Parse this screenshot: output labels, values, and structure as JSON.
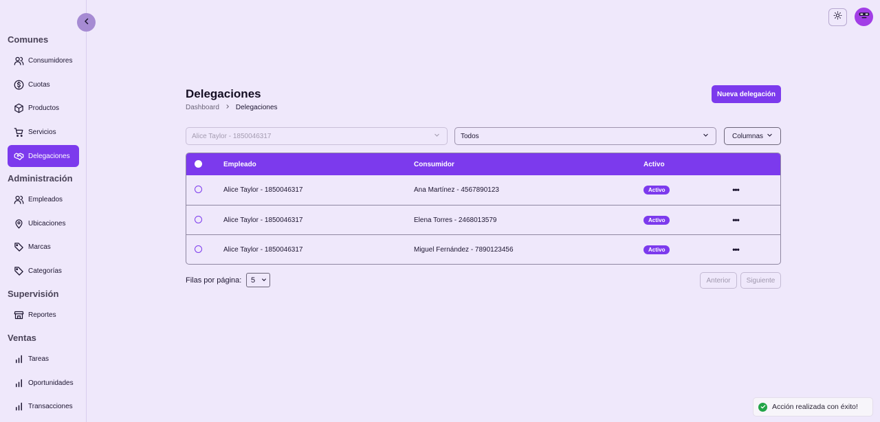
{
  "sidebar": {
    "sections": [
      {
        "title": "Comunes"
      },
      {
        "title": "Administración"
      },
      {
        "title": "Supervisión"
      },
      {
        "title": "Ventas"
      }
    ],
    "items": [
      {
        "label": "Consumidores",
        "icon": "users-icon"
      },
      {
        "label": "Cuotas",
        "icon": "dollar-circle-icon"
      },
      {
        "label": "Productos",
        "icon": "package-icon"
      },
      {
        "label": "Servicios",
        "icon": "cart-icon"
      },
      {
        "label": "Delegaciones",
        "icon": "handshake-icon",
        "active": true
      },
      {
        "label": "Empleados",
        "icon": "users-icon"
      },
      {
        "label": "Ubicaciones",
        "icon": "map-pin-icon"
      },
      {
        "label": "Marcas",
        "icon": "tag-icon"
      },
      {
        "label": "Categorías",
        "icon": "tag-icon"
      },
      {
        "label": "Reportes",
        "icon": "store-icon"
      },
      {
        "label": "Tareas",
        "icon": "bar-chart-icon"
      },
      {
        "label": "Oportunidades",
        "icon": "bar-chart-icon"
      },
      {
        "label": "Transacciones",
        "icon": "bar-chart-icon"
      }
    ]
  },
  "header": {
    "title": "Delegaciones",
    "breadcrumb": [
      "Dashboard",
      "Delegaciones"
    ],
    "new_button": "Nueva delegación"
  },
  "filters": {
    "employee_select": "Alice Taylor - 1850046317",
    "status_select": "Todos",
    "columns_button": "Columnas"
  },
  "table": {
    "columns": [
      "Empleado",
      "Consumidor",
      "Activo"
    ],
    "rows": [
      {
        "employee": "Alice Taylor - 1850046317",
        "consumer": "Ana Martínez - 4567890123",
        "status": "Activo"
      },
      {
        "employee": "Alice Taylor - 1850046317",
        "consumer": "Elena Torres - 2468013579",
        "status": "Activo"
      },
      {
        "employee": "Alice Taylor - 1850046317",
        "consumer": "Miguel Fernández - 7890123456",
        "status": "Activo"
      }
    ]
  },
  "pagination": {
    "rows_per_page_label": "Filas por página:",
    "rows_per_page_value": "5",
    "prev": "Anterior",
    "next": "Siguiente"
  },
  "toast": {
    "message": "Acción realizada con éxito!"
  },
  "colors": {
    "accent": "#7c3aed",
    "background": "#efe8fb",
    "success": "#22a447"
  }
}
